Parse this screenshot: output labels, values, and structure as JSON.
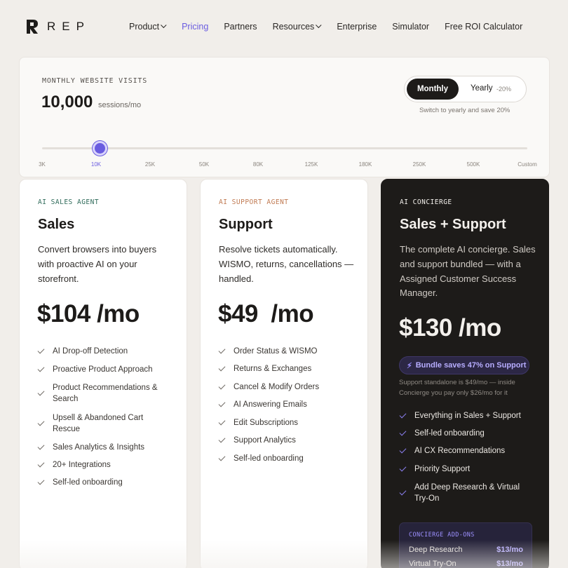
{
  "brand": {
    "name": "REP",
    "logo_icon": "r-logo-mark"
  },
  "nav": {
    "items": [
      {
        "label": "Product",
        "dropdown": true,
        "active": false
      },
      {
        "label": "Pricing",
        "dropdown": false,
        "active": true
      },
      {
        "label": "Partners",
        "dropdown": false,
        "active": false
      },
      {
        "label": "Resources",
        "dropdown": true,
        "active": false
      },
      {
        "label": "Enterprise",
        "dropdown": false,
        "active": false
      },
      {
        "label": "Simulator",
        "dropdown": false,
        "active": false
      },
      {
        "label": "Free ROI Calculator",
        "dropdown": false,
        "active": false
      }
    ],
    "accent": "#6a5ce0"
  },
  "visits": {
    "label": "MONTHLY WEBSITE VISITS",
    "value": "10,000",
    "unit": "sessions/mo",
    "selected_tick": "10K",
    "ticks": [
      "3K",
      "10K",
      "25K",
      "50K",
      "80K",
      "125K",
      "180K",
      "250K",
      "500K",
      "Custom"
    ]
  },
  "billing": {
    "monthly": "Monthly",
    "yearly": "Yearly",
    "yearly_badge": "-20%",
    "selected": "Monthly",
    "note": "Switch to yearly and save 20%"
  },
  "plans": {
    "sales": {
      "eyebrow": "AI SALES AGENT",
      "eyebrow_color": "#2f6b5a",
      "title": "Sales",
      "desc": "Convert browsers into buyers with proactive AI on your storefront.",
      "price": "$104 /mo",
      "features": [
        "AI Drop-off Detection",
        "Proactive Product Approach",
        "Product Recommendations & Search",
        "Upsell & Abandoned Cart Rescue",
        "Sales Analytics & Insights",
        "20+ Integrations",
        "Self-led onboarding"
      ]
    },
    "support": {
      "eyebrow": "AI SUPPORT AGENT",
      "eyebrow_color": "#c07a52",
      "title": "Support",
      "desc": "Resolve tickets automatically. WISMO, returns, cancellations — handled.",
      "price": "$49  /mo",
      "features": [
        "Order Status & WISMO",
        "Returns & Exchanges",
        "Cancel & Modify Orders",
        "AI Answering Emails",
        "Edit Subscriptions",
        "Support Analytics",
        "Self-led onboarding"
      ]
    },
    "concierge": {
      "eyebrow": "AI CONCIERGE",
      "title": "Sales + Support",
      "desc": "The complete AI concierge. Sales and support bundled — with a Assigned Customer Success Manager.",
      "price": "$130 /mo",
      "bundle_badge": "Bundle saves 47% on Support",
      "bundle_icon": "bolt-icon",
      "bundle_note": "Support standalone is $49/mo — inside Concierge you pay only $26/mo for it",
      "features": [
        "Everything in Sales + Support",
        "Self-led onboarding",
        "AI CX Recommendations",
        "Priority Support",
        "Add Deep Research & Virtual Try-On"
      ],
      "addons_title": "CONCIERGE ADD-ONS",
      "addons": [
        {
          "name": "Deep Research",
          "price": "$13/mo"
        },
        {
          "name": "Virtual Try-On",
          "price": "$13/mo"
        }
      ]
    }
  }
}
